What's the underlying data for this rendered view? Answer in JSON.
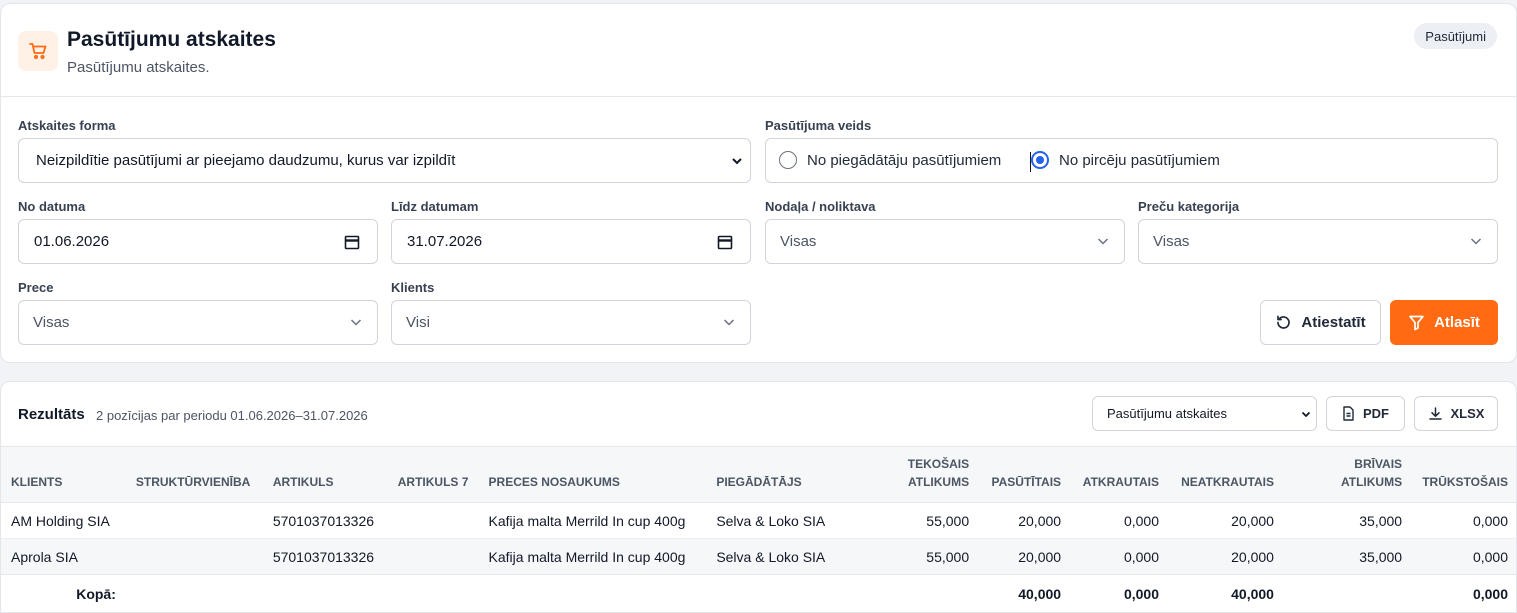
{
  "header": {
    "title": "Pasūtījumu atskaites",
    "subtitle": "Pasūtījumu atskaites.",
    "badge": "Pasūtījumi",
    "icon": "cart-icon",
    "accent_color": "#ff6a13"
  },
  "filters": {
    "report_form": {
      "label": "Atskaites forma",
      "value": "Neizpildītie pasūtījumi ar pieejamo daudzumu, kurus var izpildīt"
    },
    "order_type": {
      "label": "Pasūtījuma veids",
      "options": [
        {
          "label": "No piegādātāju pasūtījumiem",
          "selected": false
        },
        {
          "label": "No pircēju pasūtījumiem",
          "selected": true
        }
      ]
    },
    "date_from": {
      "label": "No datuma",
      "value": "01.06.2026"
    },
    "date_to": {
      "label": "Līdz datumam",
      "value": "31.07.2026"
    },
    "department": {
      "label": "Nodaļa / noliktava",
      "value": "Visas"
    },
    "category": {
      "label": "Preču kategorija",
      "value": "Visas"
    },
    "product": {
      "label": "Prece",
      "value": "Visas"
    },
    "client": {
      "label": "Klients",
      "value": "Visi"
    },
    "reset_label": "Atiestatīt",
    "apply_label": "Atlasīt"
  },
  "results": {
    "title": "Rezultāts",
    "meta": "2 pozīcijas par periodu 01.06.2026–31.07.2026",
    "report_select": "Pasūtījumu atskaites",
    "pdf_label": "PDF",
    "xlsx_label": "XLSX",
    "columns": [
      "Klients",
      "Struktūrvienība",
      "Artikuls",
      "Artikuls 7",
      "Preces nosaukums",
      "Piegādātājs",
      "Tekošais atlikums",
      "Pasūtītais",
      "Atkrautais",
      "Neatkrautais",
      "Brīvais atlikums",
      "Trūkstošais"
    ],
    "rows": [
      [
        "AM Holding SIA",
        "",
        "5701037013326",
        "",
        "Kafija malta Merrild In cup 400g",
        "Selva & Loko SIA",
        "55,000",
        "20,000",
        "0,000",
        "20,000",
        "35,000",
        "0,000"
      ],
      [
        "Aprola SIA",
        "",
        "5701037013326",
        "",
        "Kafija malta Merrild In cup 400g",
        "Selva & Loko SIA",
        "55,000",
        "20,000",
        "0,000",
        "20,000",
        "35,000",
        "0,000"
      ]
    ],
    "totals": {
      "label": "Kopā:",
      "values": [
        "",
        "",
        "",
        "",
        "",
        "",
        "",
        "40,000",
        "0,000",
        "40,000",
        "",
        "0,000"
      ]
    }
  }
}
